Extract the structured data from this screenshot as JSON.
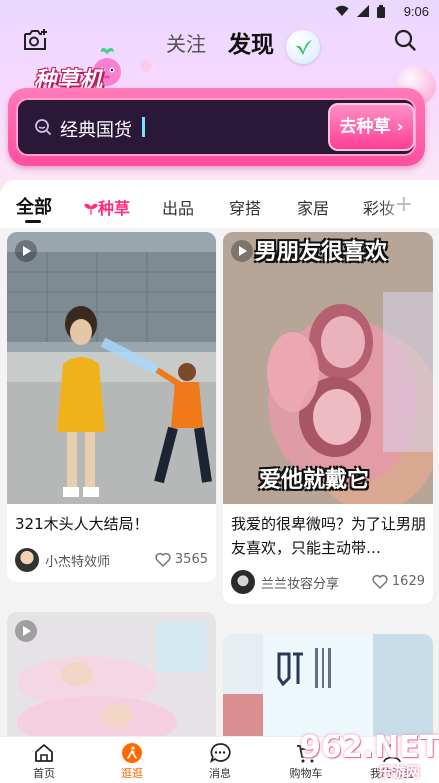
{
  "status_bar": {
    "time": "9:06"
  },
  "header": {
    "tab_follow": "关注",
    "tab_discover": "发现",
    "camera_icon": "camera-add-icon",
    "search_icon": "search-icon"
  },
  "banner": {
    "title": "种草机",
    "search_text": "经典国货",
    "button_label": "去种草"
  },
  "categories": {
    "items": [
      "全部",
      "种草",
      "出品",
      "穿搭",
      "家居",
      "彩妆"
    ],
    "active": "全部"
  },
  "feed": [
    {
      "title": "321木头人大结局！",
      "author": "小杰特效师",
      "likes": "3565",
      "has_video": true
    },
    {
      "title": "我爱的很卑微吗？为了让男朋友喜欢，只能主动带…",
      "author": "兰兰妆容分享",
      "likes": "1629",
      "has_video": true,
      "overlay_top": "男朋友很喜欢",
      "overlay_bottom": "爱他就戴它"
    },
    {
      "has_video": true
    },
    {
      "has_video": false
    }
  ],
  "bottom_nav": [
    {
      "label": "首页",
      "icon": "home-icon"
    },
    {
      "label": "逛逛",
      "icon": "stroll-icon",
      "active": true
    },
    {
      "label": "消息",
      "icon": "message-icon"
    },
    {
      "label": "购物车",
      "icon": "cart-icon"
    },
    {
      "label": "我的淘宝",
      "icon": "profile-icon"
    }
  ],
  "watermark": {
    "main": "962.NET",
    "sub": "乐游网"
  },
  "colors": {
    "accent_pink": "#ff2e7e",
    "active_nav": "#ff6a00",
    "banner_dark": "#2a1838"
  }
}
